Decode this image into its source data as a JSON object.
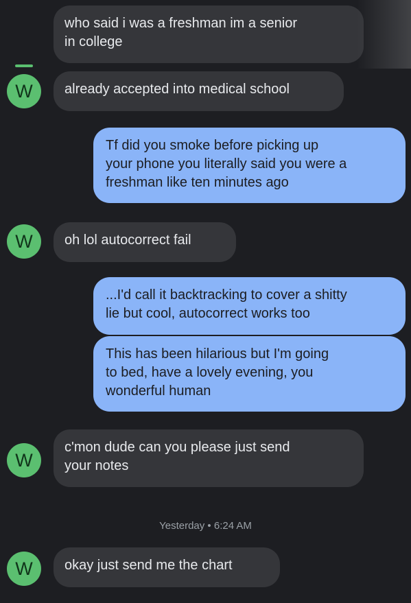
{
  "contact": {
    "avatar_letter": "W",
    "avatar_color": "#5bbf70"
  },
  "colors": {
    "background": "#1d1e22",
    "incoming_bubble": "#35363a",
    "outgoing_bubble": "#8ab4f8"
  },
  "messages": [
    {
      "direction": "incoming",
      "text": "who said i was a freshman im a senior\nin college"
    },
    {
      "direction": "incoming",
      "text": "already accepted into medical school"
    },
    {
      "direction": "outgoing",
      "text": "Tf did you smoke before picking up\nyour phone you literally said you were a\nfreshman like ten minutes ago"
    },
    {
      "direction": "incoming",
      "text": "oh lol autocorrect fail"
    },
    {
      "direction": "outgoing",
      "text": "...I'd call it backtracking to cover a shitty\nlie but cool, autocorrect works too"
    },
    {
      "direction": "outgoing",
      "text": "This has been hilarious but I'm going\nto bed, have a lovely evening, you\nwonderful human"
    },
    {
      "direction": "incoming",
      "text": "c'mon dude can you please just send\nyour notes"
    },
    {
      "direction": "incoming",
      "text": "okay just send me the chart"
    }
  ],
  "timestamp": "Yesterday • 6:24 AM"
}
